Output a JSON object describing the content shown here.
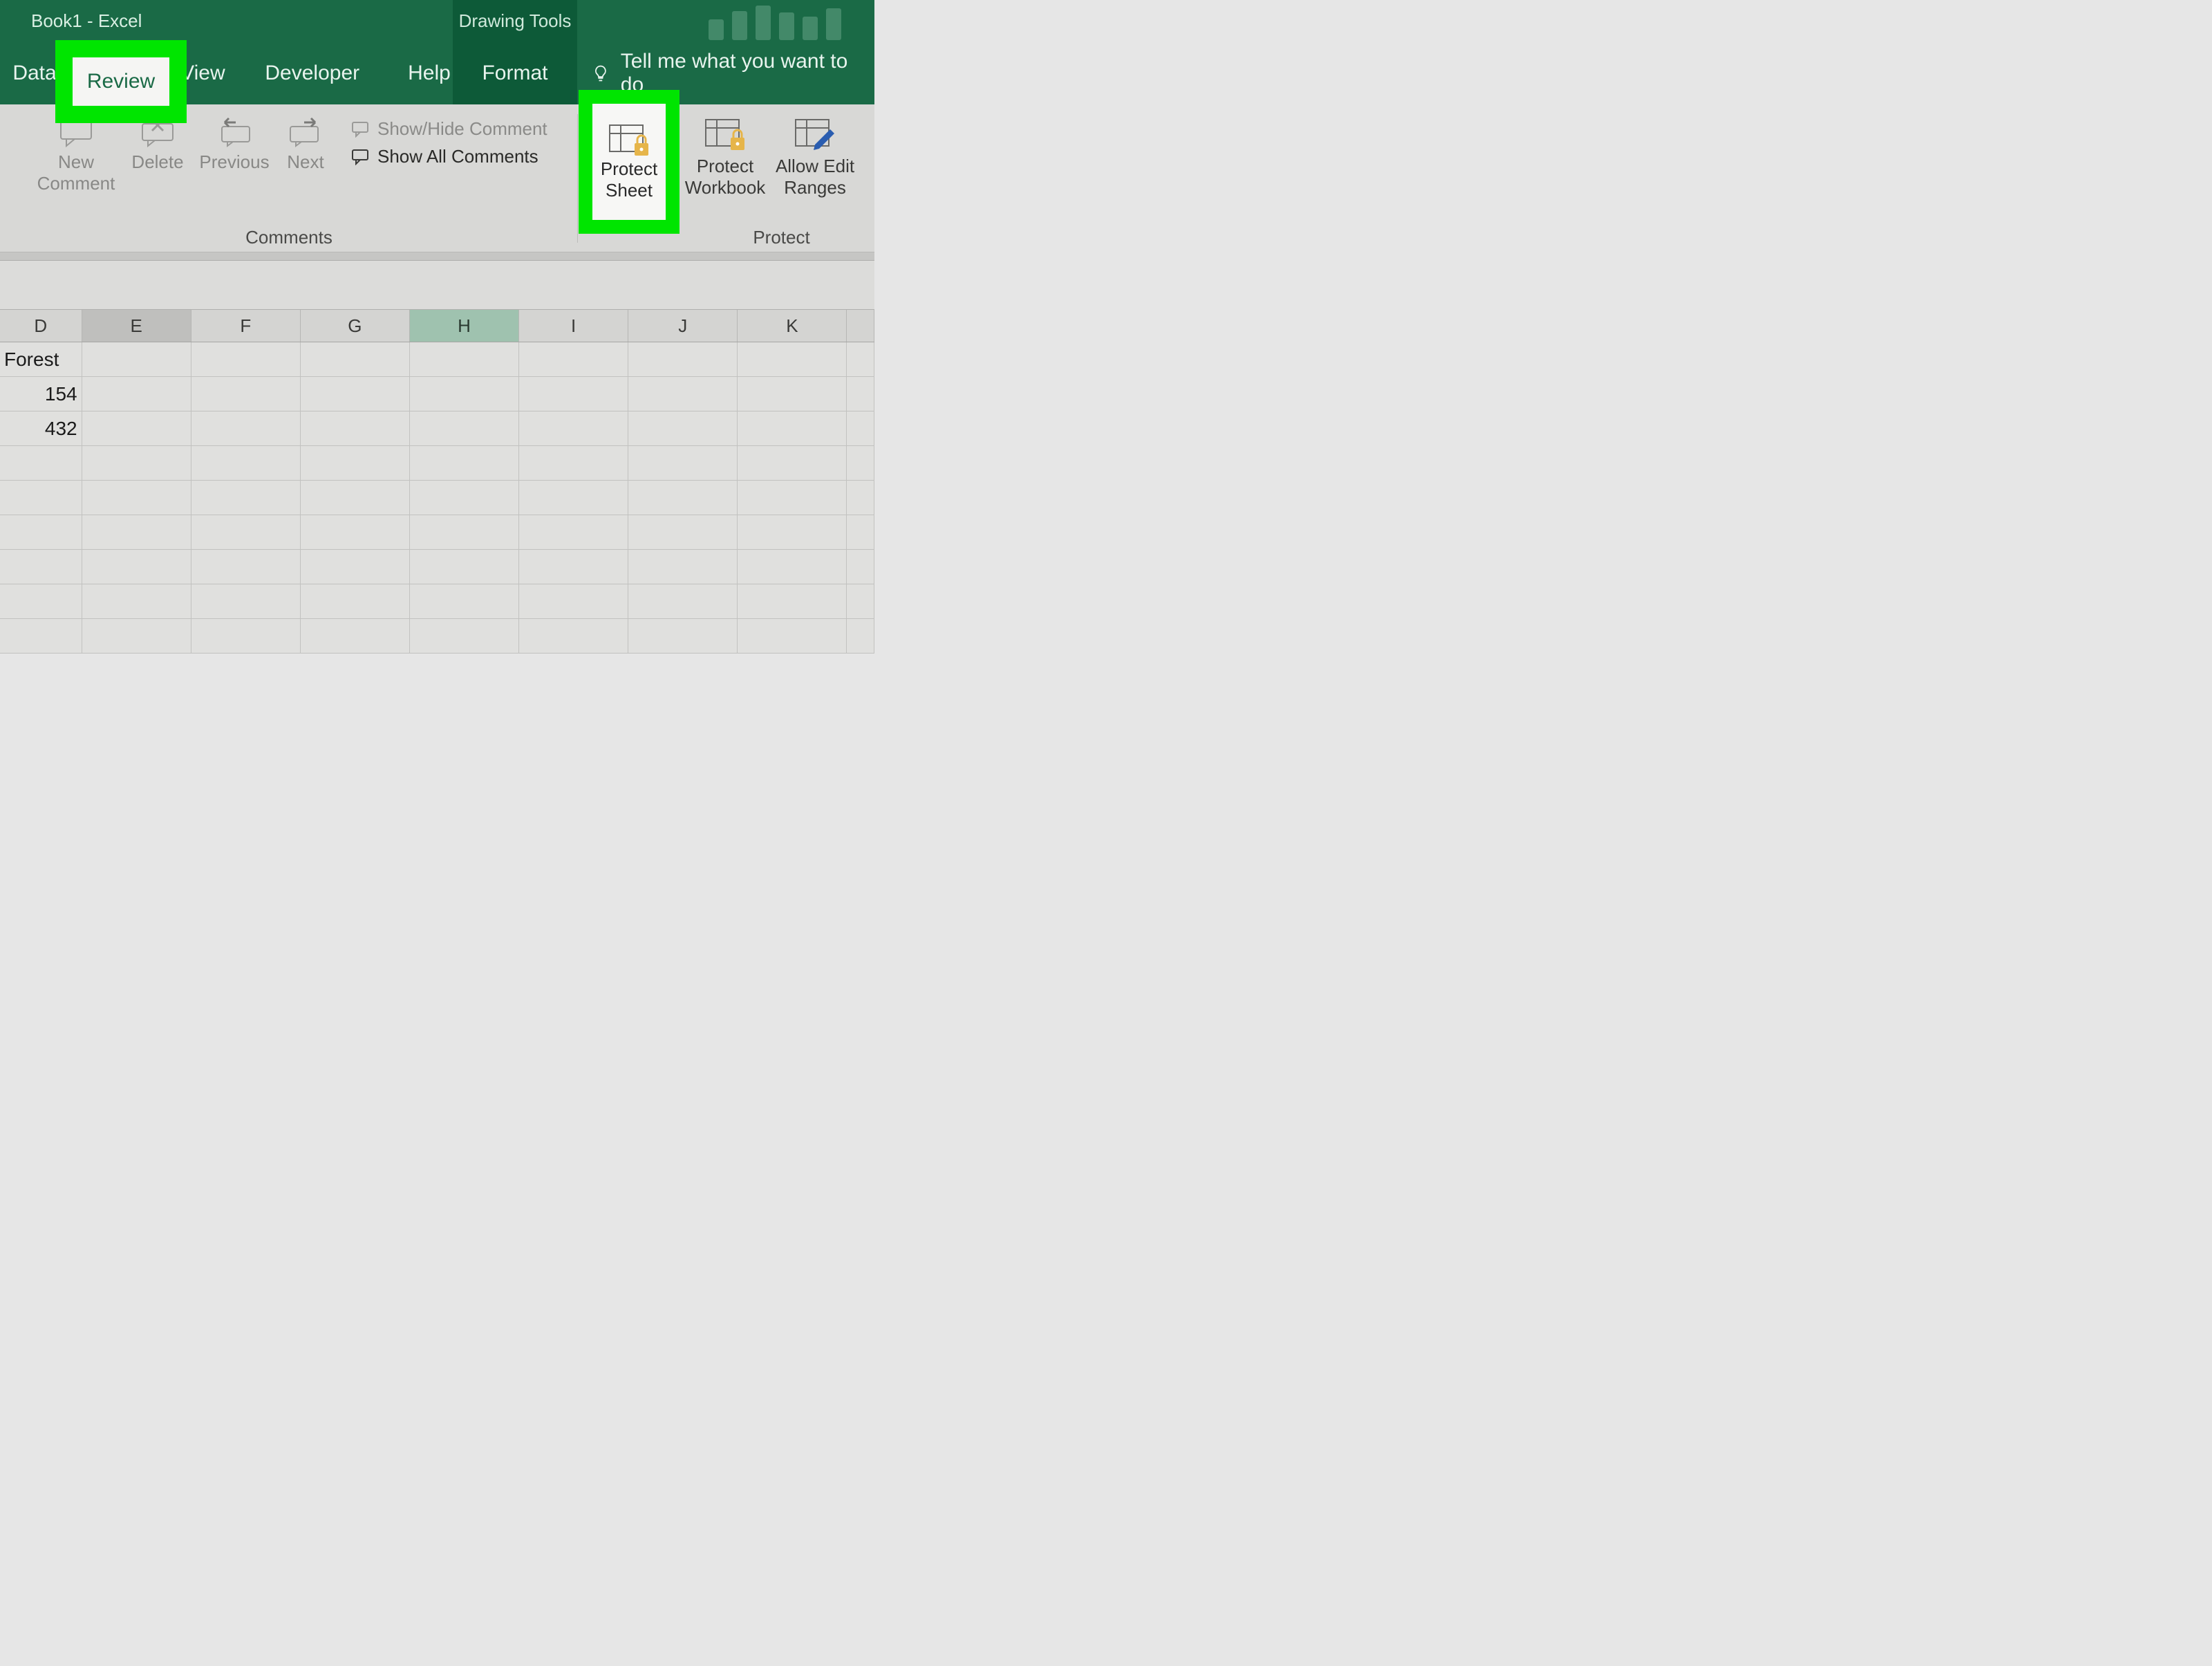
{
  "titlebar": {
    "title": "Book1  -  Excel",
    "context_tab": "Drawing Tools"
  },
  "tabs": {
    "data": "Data",
    "review": "Review",
    "view": "View",
    "developer": "Developer",
    "help": "Help",
    "format": "Format",
    "tellme": "Tell me what you want to do"
  },
  "ribbon": {
    "comments_group": {
      "label": "Comments",
      "new_comment_line1": "New",
      "new_comment_line2": "Comment",
      "delete": "Delete",
      "previous": "Previous",
      "next": "Next",
      "show_hide": "Show/Hide Comment",
      "show_all": "Show All Comments"
    },
    "protect_group": {
      "label": "Protect",
      "protect_sheet_line1": "Protect",
      "protect_sheet_line2": "Sheet",
      "protect_workbook_line1": "Protect",
      "protect_workbook_line2": "Workbook",
      "allow_edit_line1": "Allow Edit",
      "allow_edit_line2": "Ranges"
    }
  },
  "columns": [
    "D",
    "E",
    "F",
    "G",
    "H",
    "I",
    "J",
    "K"
  ],
  "sheet": {
    "rows": [
      {
        "D": "Forest"
      },
      {
        "D": "154"
      },
      {
        "D": "432"
      },
      {},
      {},
      {},
      {},
      {},
      {}
    ]
  }
}
